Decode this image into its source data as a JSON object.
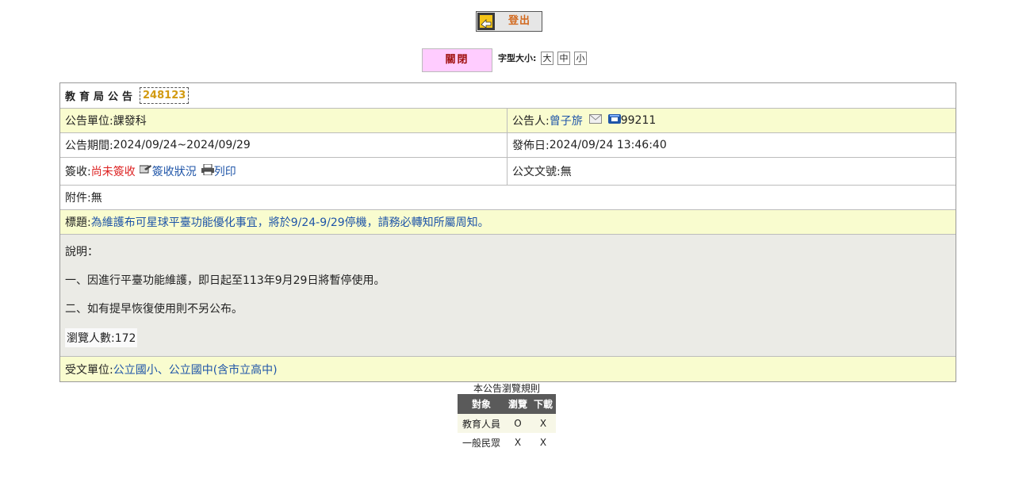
{
  "logout": {
    "label": "登出"
  },
  "controls": {
    "close_label": "關閉",
    "font_size_label": "字型大小:",
    "font_sizes": [
      "大",
      "中",
      "小"
    ]
  },
  "notice": {
    "header": "教育局公告",
    "id": "248123",
    "unit_label": "公告單位:",
    "unit": "課發科",
    "announcer_label": "公告人:",
    "announcer": "曾子旂",
    "phone": "99211",
    "period_label": "公告期間:",
    "period": "2024/09/24~2024/09/29",
    "publish_label": "發佈日:",
    "publish_date": "2024/09/24 13:46:40",
    "sign_label": "簽收:",
    "sign_status": "尚未簽收",
    "sign_status_link": "簽收狀況",
    "print_link": "列印",
    "doc_no_label": "公文文號:",
    "doc_no": "無",
    "attachment_label": "附件:",
    "attachment": "無",
    "subject_label": "標題:",
    "subject": "為維護布可星球平臺功能優化事宜，將於9/24-9/29停機，請務必轉知所屬周知。",
    "description_lines": [
      "說明：",
      "一、因進行平臺功能維護，即日起至113年9月29日將暫停使用。",
      "二、如有提早恢復使用則不另公布。"
    ],
    "views_label": "瀏覽人數:",
    "views": "172",
    "recipients_label": "受文單位:",
    "recipients": "公立國小、公立國中(含市立高中)"
  },
  "rules": {
    "title": "本公告瀏覽規則",
    "headers": [
      "對象",
      "瀏覽",
      "下載"
    ],
    "rows": [
      [
        "教育人員",
        "O",
        "X"
      ],
      [
        "一般民眾",
        "X",
        "X"
      ]
    ]
  },
  "icons": {
    "logout": "logout-arrow-icon",
    "mail": "mail-icon",
    "phone": "phone-icon",
    "sign_status": "sign-status-icon",
    "print": "printer-icon"
  }
}
